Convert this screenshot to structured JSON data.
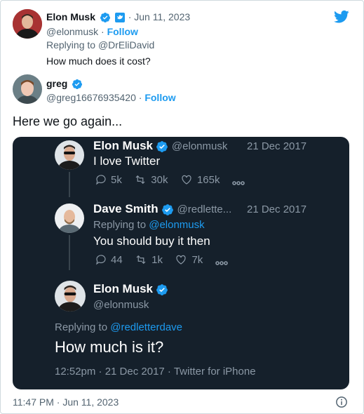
{
  "reply_tweet": {
    "author_name": "Elon Musk",
    "timestamp": "· Jun 11, 2023",
    "handle": "@elonmusk ·",
    "follow_label": "Follow",
    "replying_prefix": "Replying to",
    "replying_to": "@DrEliDavid",
    "text": "How much does it cost?"
  },
  "main_tweet": {
    "author_name": "greg",
    "handle": "@greg16676935420 ·",
    "follow_label": "Follow",
    "text": "Here we go again..."
  },
  "embedded": {
    "tweet1": {
      "name": "Elon Musk",
      "handle": "@elonmusk",
      "date": "21 Dec 2017",
      "text": "I love Twitter",
      "replies": "5k",
      "retweets": "30k",
      "likes": "165k"
    },
    "tweet2": {
      "name": "Dave Smith",
      "handle": "@redlette...",
      "date": "21 Dec 2017",
      "replying_prefix": "Replying to",
      "replying_to": "@elonmusk",
      "text": "You should buy it then",
      "replies": "44",
      "retweets": "1k",
      "likes": "7k"
    },
    "tweet3": {
      "name": "Elon Musk",
      "handle": "@elonmusk",
      "replying_prefix": "Replying to",
      "replying_to": "@redletterdave",
      "text": "How much is it?",
      "footer": "12:52pm · 21 Dec 2017 · Twitter for iPhone"
    }
  },
  "footer": {
    "timestamp": "11:47 PM · Jun 11, 2023"
  },
  "colors": {
    "twitter_blue": "#1d9bf0",
    "dark_bg": "#15202b",
    "text": "#0f1419",
    "muted": "#536471"
  },
  "icons": [
    "twitter-bird-icon",
    "verified-badge-icon",
    "twitter-blue-badge-icon",
    "reply-icon",
    "retweet-icon",
    "like-icon",
    "more-icon",
    "info-icon"
  ]
}
